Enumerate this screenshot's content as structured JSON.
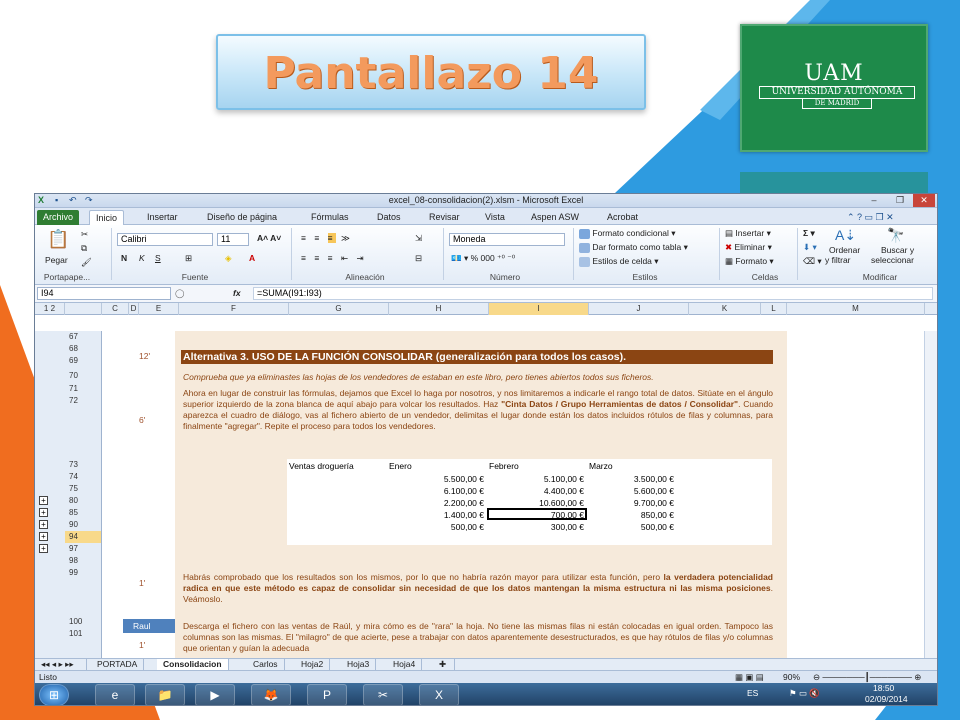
{
  "slide": {
    "title": "Pantallazo 14",
    "logo": {
      "uam": "UAM",
      "university": "UNIVERSIDAD AUTÓNOMA",
      "city": "DE MADRID"
    },
    "colors": {
      "orange": "#f06d1f",
      "blue": "#2e9be0",
      "logo_green": "#1e8a4a"
    }
  },
  "excel": {
    "window_title": "excel_08-consolidacion(2).xlsm - Microsoft Excel",
    "tabs": [
      "Archivo",
      "Inicio",
      "Insertar",
      "Diseño de página",
      "Fórmulas",
      "Datos",
      "Revisar",
      "Vista",
      "Aspen ASW",
      "Acrobat"
    ],
    "ribbon": {
      "paste": "Pegar",
      "clipboard": "Portapape...",
      "font_name": "Calibri",
      "font_size": "11",
      "font_group": "Fuente",
      "align_group": "Alineación",
      "number_format": "Moneda",
      "number_group": "Número",
      "cond_format": "Formato condicional",
      "table_format": "Dar formato como tabla",
      "cell_styles": "Estilos de celda",
      "styles_group": "Estilos",
      "insert": "Insertar",
      "delete": "Eliminar",
      "format": "Formato",
      "cells_group": "Celdas",
      "sort": "Ordenar",
      "sort2": "y filtrar",
      "find": "Buscar y",
      "find2": "seleccionar",
      "modify_group": "Modificar"
    },
    "formula_bar": {
      "name_box": "I94",
      "fx": "fx",
      "formula": "=SUMA(I91:I93)"
    },
    "columns": [
      "C",
      "D",
      "E",
      "F",
      "G",
      "H",
      "I",
      "J",
      "K",
      "L",
      "M"
    ],
    "selected_column": "I",
    "outline_levels": [
      "1",
      "2"
    ],
    "rows": [
      "67",
      "68",
      "69",
      "70",
      "71",
      "72",
      "73",
      "74",
      "75",
      "80",
      "85",
      "90",
      "94",
      "97",
      "98",
      "99",
      "100",
      "101"
    ],
    "selected_row": "94",
    "times": {
      "t1": "12'",
      "t2": "6'",
      "t3": "1'",
      "t4": "1'"
    },
    "heading": "Alternativa 3. USO DE LA FUNCIÓN CONSOLIDAR (generalización para todos los casos).",
    "p1": "Comprueba que ya eliminastes las hojas de los vendedores de estaban en este libro, pero tienes abiertos todos sus ficheros.",
    "p2a": "Ahora en lugar de construir las fórmulas, dejamos que Excel lo haga por nosotros, y nos limitaremos a indicarle el rango total de datos. Sitúate en el ángulo superior izquierdo de la zona blanca de aquí abajo para volcar los resultados. Haz ",
    "p2b": "\"Cinta Datos / Grupo Herramientas de datos / Consolidar\"",
    "p2c": ". Cuando aparezca el cuadro de diálogo, vas al fichero abierto de un vendedor, delimitas el lugar donde están los datos incluidos rótulos de filas y columnas, para finalmente \"agregar\". Repite el proceso para todos los vendedores.",
    "table": {
      "corner": "Ventas droguería",
      "headers": [
        "Enero",
        "Febrero",
        "Marzo"
      ],
      "rows": [
        [
          "5.500,00 €",
          "5.100,00 €",
          "3.500,00 €"
        ],
        [
          "6.100,00 €",
          "4.400,00 €",
          "5.600,00 €"
        ],
        [
          "2.200,00 €",
          "10.600,00 €",
          "9.700,00 €"
        ],
        [
          "1.400,00 €",
          "700,00 €",
          "850,00 €"
        ],
        [
          "500,00 €",
          "300,00 €",
          "500,00 €"
        ]
      ]
    },
    "p3a": "Habrás comprobado que los resultados son los mismos, por lo que no habría razón mayor para utilizar esta función, pero ",
    "p3b": "la verdadera potencialidad radica en que este método es capaz de consolidar sin necesidad de que los datos mantengan la misma estructura ni las misma posiciones",
    "p3c": ". Veámoslo.",
    "p4": "Descarga el fichero con las ventas de Raúl, y mira cómo es de \"rara\" la hoja. No tiene las mismas filas ni están colocadas en igual orden. Tampoco las columnas son las mismas. El \"milagro\" de que acierte, pese a trabajar con datos aparentemente desestructurados, es que hay rótulos de filas y/o columnas que orientan y guían la adecuada",
    "shape_label": "Raul",
    "sheets": [
      "PORTADA",
      "Consolidacion",
      "Carlos",
      "Hoja2",
      "Hoja3",
      "Hoja4"
    ],
    "active_sheet": "Consolidacion",
    "status": "Listo",
    "zoom": "90%",
    "taskbar": {
      "lang": "ES",
      "time": "18:50",
      "date": "02/09/2014"
    }
  }
}
